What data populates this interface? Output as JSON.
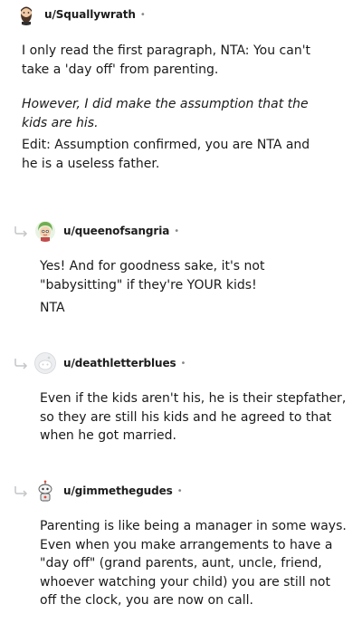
{
  "comments": [
    {
      "username": "u/Squallywrath",
      "separator": "•",
      "avatar": "bearded-man-avatar",
      "paragraphs": [
        "I only read the first paragraph, NTA: You can't take a 'day off' from parenting.",
        "However, I did make the assumption that the kids are his.",
        "Edit: Assumption confirmed, you are NTA and he is a useless father."
      ]
    },
    {
      "username": "u/queenofsangria",
      "separator": "•",
      "avatar": "green-hair-avatar",
      "paragraphs": [
        "Yes! And for goodness sake, it's not \"babysitting\" if they're YOUR kids!",
        "NTA"
      ]
    },
    {
      "username": "u/deathletterblues",
      "separator": "•",
      "avatar": "default-snoo-avatar",
      "paragraphs": [
        "Even if the kids aren't his, he is their stepfather, so they are still his kids and he agreed to that when he got married."
      ]
    },
    {
      "username": "u/gimmethegudes",
      "separator": "•",
      "avatar": "robot-snoo-avatar",
      "paragraphs": [
        "Parenting is like being a manager in some ways. Even when you make arrangements to have a \"day off\" (grand parents, aunt, uncle, friend, whoever watching your child) you are still not off the clock, you are now on call."
      ]
    }
  ]
}
